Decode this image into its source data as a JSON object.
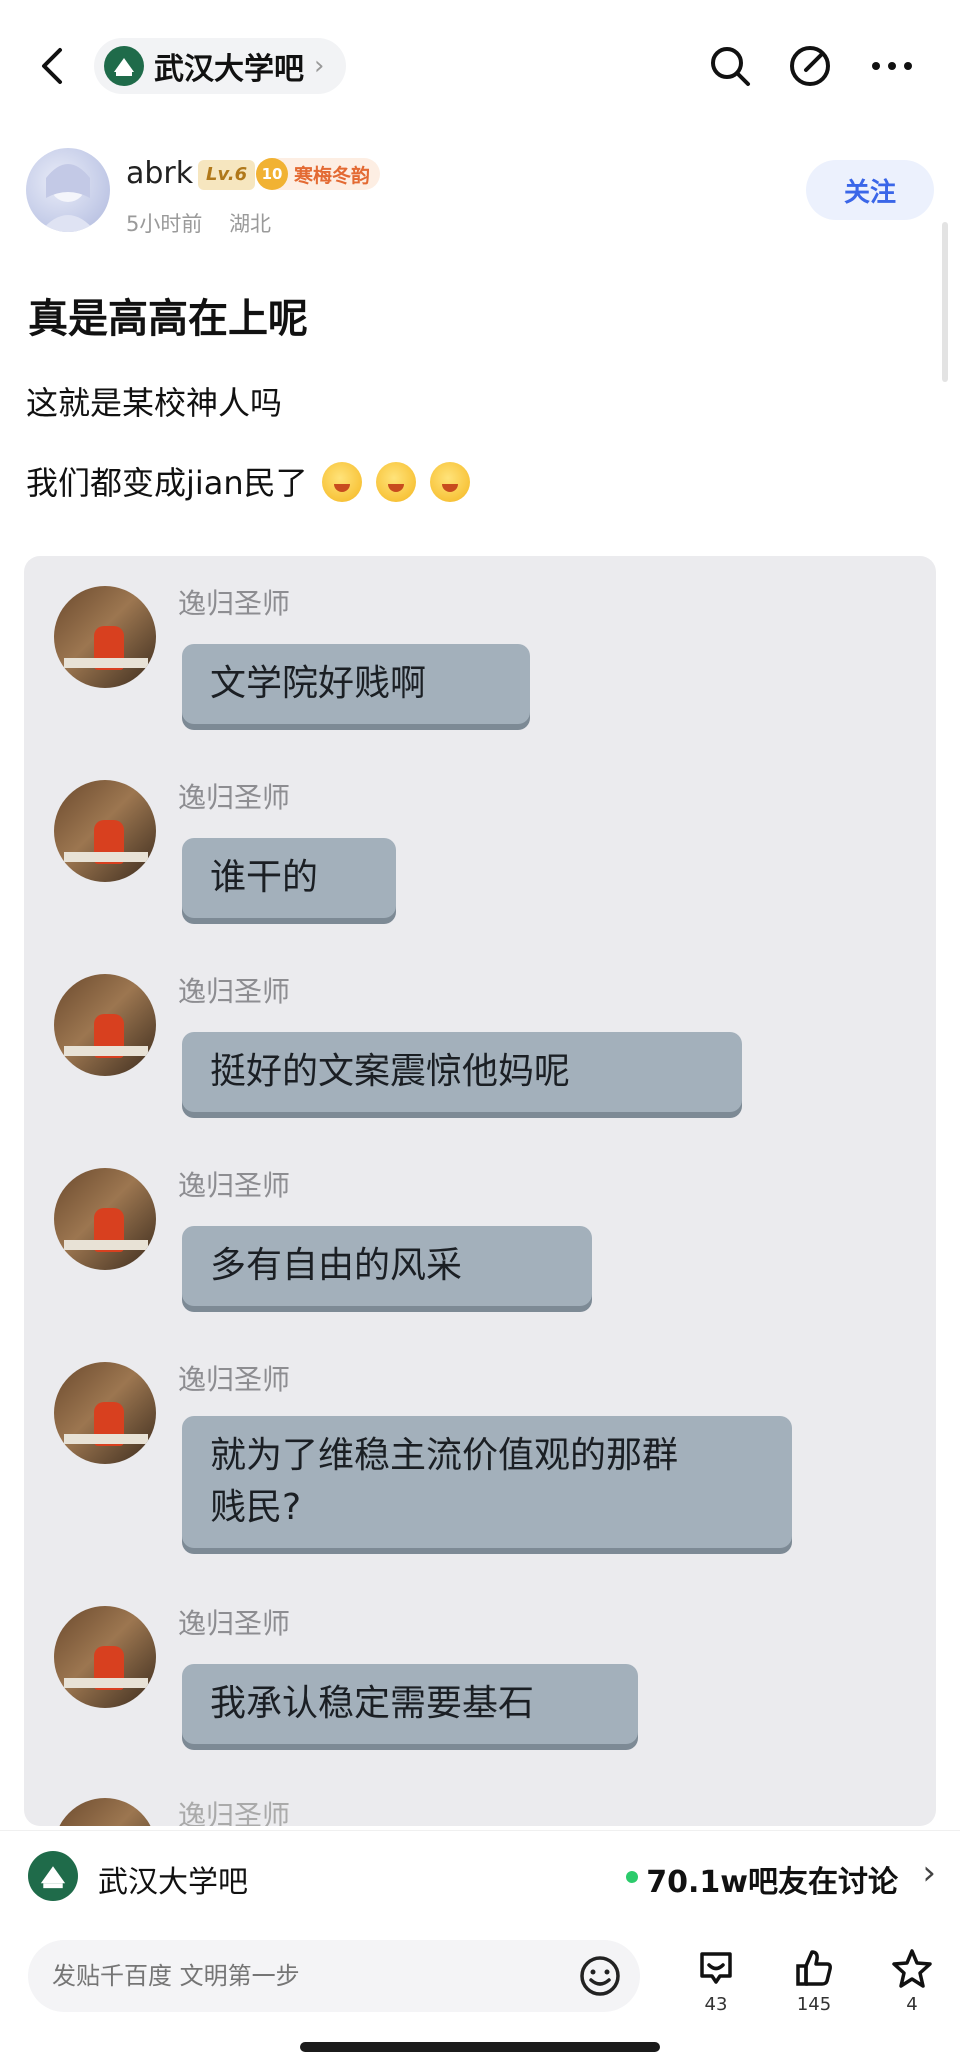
{
  "nav": {
    "forum_name": "武汉大学吧",
    "chevron": "›"
  },
  "author": {
    "name": "abrk",
    "level": "Lv.6",
    "title_level": "10",
    "title": "寒梅冬韵",
    "time": "5小时前",
    "location": "湖北",
    "follow_label": "关注"
  },
  "post": {
    "title": "真是高高在上呢",
    "line1": "这就是某校神人吗",
    "line2": "我们都变成jian民了"
  },
  "embed": {
    "messages": [
      {
        "sender": "逸归圣师",
        "text": "文学院好贱啊"
      },
      {
        "sender": "逸归圣师",
        "text": "谁干的"
      },
      {
        "sender": "逸归圣师",
        "text": "挺好的文案震惊他妈呢"
      },
      {
        "sender": "逸归圣师",
        "text": "多有自由的风采"
      },
      {
        "sender": "逸归圣师",
        "text": "就为了维稳主流价值观的那群\n贱民?"
      },
      {
        "sender": "逸归圣师",
        "text": "我承认稳定需要基石"
      },
      {
        "sender": "逸归圣师",
        "text": ""
      }
    ]
  },
  "forum_bar": {
    "name": "武汉大学吧",
    "online": "70.1w吧友在讨论",
    "arrow": "›"
  },
  "toolbar": {
    "reply_placeholder": "发贴千百度 文明第一步",
    "comments": "43",
    "likes": "145",
    "favorites": "4"
  },
  "colors": {
    "accent": "#3a66e8",
    "bubble": "#a3b0bb",
    "online_dot": "#2bcb6b",
    "forum_logo": "#1f6b4a"
  },
  "icons": [
    "back-icon",
    "forum-logo-icon",
    "search-icon",
    "edit-icon",
    "more-icon",
    "emoji-icon",
    "comment-icon",
    "like-icon",
    "star-icon"
  ]
}
